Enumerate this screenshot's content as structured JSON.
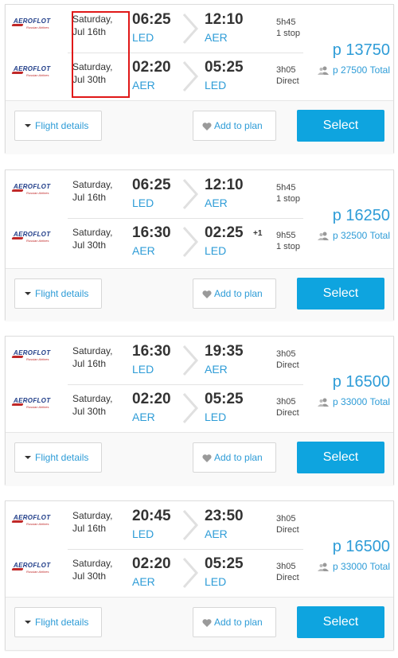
{
  "airline": {
    "name": "AEROFLOT",
    "subtitle": "Russian Airlines"
  },
  "buttons": {
    "flight_details": "Flight details",
    "add_to_plan": "Add to plan",
    "select": "Select"
  },
  "results": [
    {
      "outbound": {
        "date_day": "Saturday,",
        "date": "Jul 16th",
        "dep_time": "06:25",
        "dep_code": "LED",
        "arr_time": "12:10",
        "arr_code": "AER",
        "day_offset": "",
        "duration": "5h45",
        "stops": "1 stop"
      },
      "return": {
        "date_day": "Saturday,",
        "date": "Jul 30th",
        "dep_time": "02:20",
        "dep_code": "AER",
        "arr_time": "05:25",
        "arr_code": "LED",
        "day_offset": "",
        "duration": "3h05",
        "stops": "Direct"
      },
      "price": "р 13750",
      "total": "р 27500 Total"
    },
    {
      "outbound": {
        "date_day": "Saturday,",
        "date": "Jul 16th",
        "dep_time": "06:25",
        "dep_code": "LED",
        "arr_time": "12:10",
        "arr_code": "AER",
        "day_offset": "",
        "duration": "5h45",
        "stops": "1 stop"
      },
      "return": {
        "date_day": "Saturday,",
        "date": "Jul 30th",
        "dep_time": "16:30",
        "dep_code": "AER",
        "arr_time": "02:25",
        "arr_code": "LED",
        "day_offset": "+1",
        "duration": "9h55",
        "stops": "1 stop"
      },
      "price": "р 16250",
      "total": "р 32500 Total"
    },
    {
      "outbound": {
        "date_day": "Saturday,",
        "date": "Jul 16th",
        "dep_time": "16:30",
        "dep_code": "LED",
        "arr_time": "19:35",
        "arr_code": "AER",
        "day_offset": "",
        "duration": "3h05",
        "stops": "Direct"
      },
      "return": {
        "date_day": "Saturday,",
        "date": "Jul 30th",
        "dep_time": "02:20",
        "dep_code": "AER",
        "arr_time": "05:25",
        "arr_code": "LED",
        "day_offset": "",
        "duration": "3h05",
        "stops": "Direct"
      },
      "price": "р 16500",
      "total": "р 33000 Total"
    },
    {
      "outbound": {
        "date_day": "Saturday,",
        "date": "Jul 16th",
        "dep_time": "20:45",
        "dep_code": "LED",
        "arr_time": "23:50",
        "arr_code": "AER",
        "day_offset": "",
        "duration": "3h05",
        "stops": "Direct"
      },
      "return": {
        "date_day": "Saturday,",
        "date": "Jul 30th",
        "dep_time": "02:20",
        "dep_code": "AER",
        "arr_time": "05:25",
        "arr_code": "LED",
        "day_offset": "",
        "duration": "3h05",
        "stops": "Direct"
      },
      "price": "р 16500",
      "total": "р 33000 Total"
    }
  ],
  "colors": {
    "accent": "#2e9cd7",
    "select_button": "#0ea4df",
    "highlight": "#e01818"
  }
}
